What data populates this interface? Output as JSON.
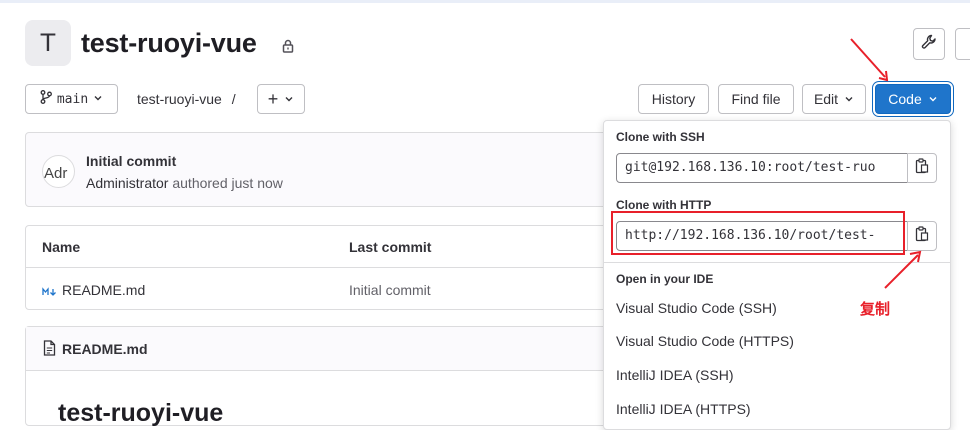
{
  "project": {
    "avatar_letter": "T",
    "title": "test-ruoyi-vue"
  },
  "toolbar": {
    "branch": "main",
    "breadcrumb": "test-ruoyi-vue",
    "breadcrumb_sep": "/",
    "plus_label": "+",
    "history": "History",
    "find_file": "Find file",
    "edit": "Edit",
    "code": "Code"
  },
  "commit": {
    "title": "Initial commit",
    "author": "Administrator",
    "action": "authored just now",
    "avatar_alt": "Adr"
  },
  "files_table": {
    "columns": [
      "Name",
      "Last commit"
    ],
    "rows": [
      {
        "name": "README.md",
        "last_commit": "Initial commit"
      }
    ]
  },
  "readme": {
    "header": "README.md",
    "heading": "test-ruoyi-vue"
  },
  "code_dropdown": {
    "ssh_label": "Clone with SSH",
    "ssh_url": "git@192.168.136.10:root/test-ruo",
    "http_label": "Clone with HTTP",
    "http_url": "http://192.168.136.10/root/test-",
    "ide_label": "Open in your IDE",
    "ide_items": [
      "Visual Studio Code (SSH)",
      "Visual Studio Code (HTTPS)",
      "IntelliJ IDEA (SSH)",
      "IntelliJ IDEA (HTTPS)"
    ]
  },
  "annotation": {
    "text": "复制",
    "color": "#e8202a"
  },
  "colors": {
    "primary": "#1f75cb",
    "border": "#dcdcde",
    "text": "#333238"
  },
  "icons": [
    "lock-icon",
    "wrench-icon",
    "branch-icon",
    "chevron-down-icon",
    "markdown-icon",
    "file-icon",
    "copy-icon"
  ]
}
